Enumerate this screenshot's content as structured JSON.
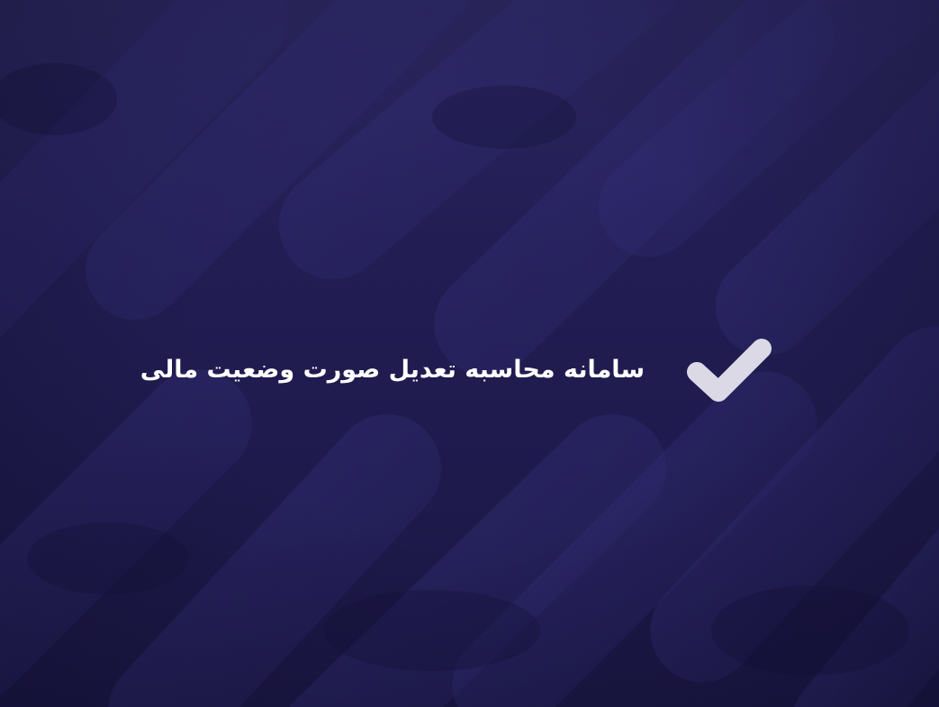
{
  "brand": {
    "title": "سامانه محاسبه تعدیل صورت وضعیت مالی"
  },
  "icons": {
    "logo": "checkmark-logo-icon"
  },
  "colors": {
    "background": "#221e54",
    "background_shape": "#302b6b",
    "title_text": "#ffffff",
    "logo_fill": "#dcd9e6"
  }
}
